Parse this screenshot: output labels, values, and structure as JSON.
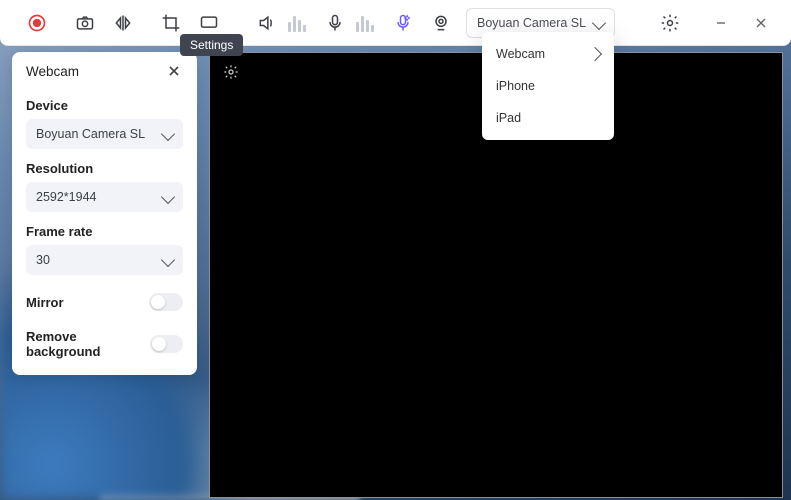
{
  "toolbar": {
    "tooltip_settings": "Settings",
    "camera_selected": "Boyuan Camera SL"
  },
  "dropdown": {
    "items": [
      "Webcam",
      "iPhone",
      "iPad"
    ]
  },
  "panel": {
    "title": "Webcam",
    "device_label": "Device",
    "device_value": "Boyuan Camera SL",
    "resolution_label": "Resolution",
    "resolution_value": "2592*1944",
    "framerate_label": "Frame rate",
    "framerate_value": "30",
    "mirror_label": "Mirror",
    "remove_bg_label": "Remove background"
  }
}
